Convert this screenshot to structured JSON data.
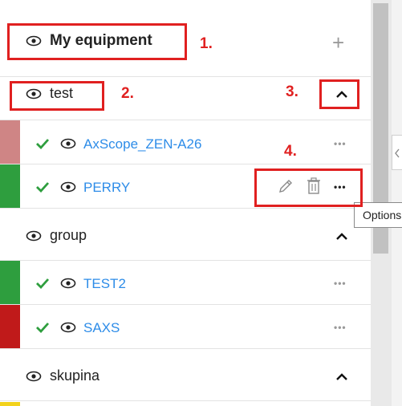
{
  "header": {
    "title": "My equipment",
    "add_label": "+"
  },
  "groups": [
    {
      "name": "test",
      "items": [
        {
          "name": "AxScope_ZEN-A26",
          "stripe_color": "#cf8585"
        },
        {
          "name": "PERRY",
          "stripe_color": "#2e9e3e"
        }
      ]
    },
    {
      "name": "group",
      "items": [
        {
          "name": "TEST2",
          "stripe_color": "#2e9e3e"
        },
        {
          "name": "SAXS",
          "stripe_color": "#c01a1a"
        }
      ]
    },
    {
      "name": "skupina",
      "items": [
        {
          "name": "",
          "stripe_color": "#f2d21b"
        }
      ]
    }
  ],
  "more_label": "•••",
  "tooltip": {
    "text": "Options"
  },
  "annotations": [
    "1.",
    "2.",
    "3.",
    "4."
  ],
  "colors": {
    "accent_link": "#2d8ce8",
    "check": "#2e9e3e",
    "annotation": "#e02020"
  },
  "icons": [
    "eye-icon",
    "check-icon",
    "plus-icon",
    "chevron-up-icon",
    "pencil-icon",
    "trash-icon",
    "more-options-icon",
    "chevron-left-icon"
  ]
}
